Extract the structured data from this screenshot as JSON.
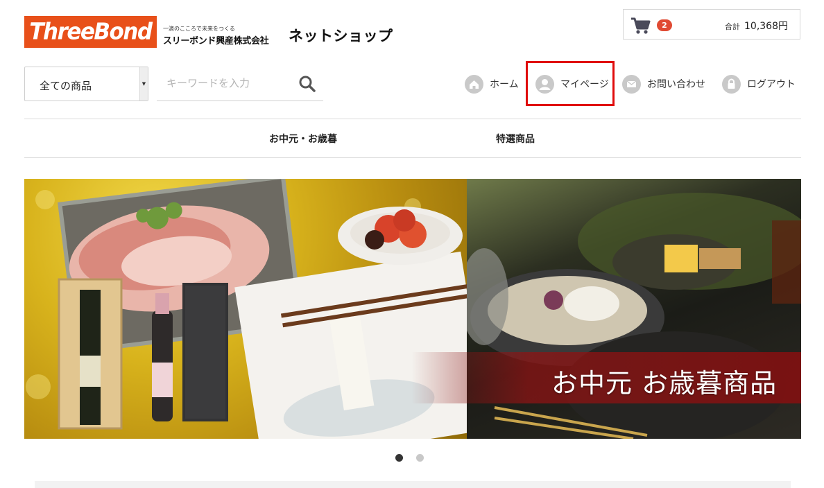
{
  "header": {
    "logo_text": "ThreeBond",
    "company_tagline": "一滴のこころで未来をつくる",
    "company_name": "スリーボンド興産株式会社",
    "shop_title": "ネットショップ"
  },
  "cart": {
    "icon": "cart-icon",
    "count": "2",
    "total_label": "合計",
    "total_value": "10,368円",
    "badge_color": "#e04a33"
  },
  "search": {
    "category_selected": "全ての商品",
    "placeholder": "キーワードを入力",
    "icon": "search-icon"
  },
  "nav": {
    "items": [
      {
        "label": "ホーム",
        "icon": "home-icon"
      },
      {
        "label": "マイページ",
        "icon": "user-icon",
        "highlighted": true
      },
      {
        "label": "お問い合わせ",
        "icon": "mail-icon"
      },
      {
        "label": "ログアウト",
        "icon": "lock-icon"
      }
    ]
  },
  "categories": [
    {
      "label": "お中元・お歳暮"
    },
    {
      "label": "特選商品"
    }
  ],
  "banner": {
    "caption": "お中元 お歳暮商品",
    "active_slide": 1,
    "slide_count": 2
  },
  "colors": {
    "brand": "#e8501a",
    "highlight": "#e00b0b",
    "dot_active": "#333333",
    "dot_inactive": "#c8c8c8"
  }
}
